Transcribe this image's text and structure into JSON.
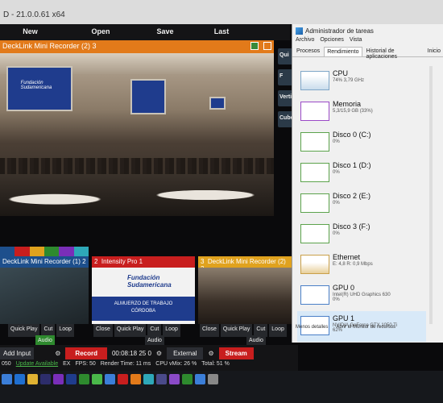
{
  "window": {
    "title": "D - 21.0.0.61 x64"
  },
  "menu": [
    "New",
    "Open",
    "Save",
    "Last"
  ],
  "preview": {
    "title": "DeckLink Mini Recorder (2) 3",
    "screen_text": "Fundación Sudamericana"
  },
  "quick_buttons": [
    "Qui",
    "F",
    "Vertic",
    "Cubo"
  ],
  "inputs": [
    {
      "number": "",
      "title": "DeckLink Mini Recorder (1) 2"
    },
    {
      "number": "2",
      "title": "Intensity Pro 1",
      "lower_third": "ALMUERZO DE TRABAJO\nCÓRDOBA",
      "logo": "Fundación Sudamericana"
    },
    {
      "number": "3",
      "title": "DeckLink Mini Recorder (2) 3"
    }
  ],
  "input_controls": {
    "i1": [
      "Quick Play",
      "Cut",
      "Loop"
    ],
    "i1b": [
      "Audio"
    ],
    "i2": [
      "Close",
      "Quick Play",
      "Cut",
      "Loop"
    ],
    "i2b": [
      "Audio"
    ],
    "i3": [
      "Close",
      "Quick Play",
      "Cut",
      "Loop"
    ],
    "i3b": [
      "Audio"
    ]
  },
  "bottom": {
    "add_input": "Add Input",
    "record": "Record",
    "timecode": "00:08:18 25 0",
    "external": "External",
    "stream": "Stream"
  },
  "status": {
    "version": "050",
    "update": "Update Available",
    "ex": "EX",
    "fps": "FPS: 50",
    "render": "Render Time: 11 ms",
    "cpu": "CPU vMix: 26 %",
    "total": "Total: 51 %"
  },
  "task_manager": {
    "title": "Administrador de tareas",
    "menu": [
      "Archivo",
      "Opciones",
      "Vista"
    ],
    "tabs": [
      "Procesos",
      "Rendimiento",
      "Historial de aplicaciones",
      "Inicio"
    ],
    "active_tab": "Rendimiento",
    "resources": [
      {
        "name": "CPU",
        "detail": "74%  3,79 GHz",
        "kind": "cpu"
      },
      {
        "name": "Memoria",
        "detail": "5,3/15,9 GB (33%)",
        "kind": "mem"
      },
      {
        "name": "Disco 0 (C:)",
        "detail": "0%",
        "kind": "disk"
      },
      {
        "name": "Disco 1 (D:)",
        "detail": "0%",
        "kind": "disk"
      },
      {
        "name": "Disco 2 (E:)",
        "detail": "0%",
        "kind": "disk"
      },
      {
        "name": "Disco 3 (F:)",
        "detail": "0%",
        "kind": "disk"
      },
      {
        "name": "Ethernet",
        "detail": "E: 4,8  R: 0,9 Mbps",
        "kind": "net"
      },
      {
        "name": "GPU 0",
        "detail": "Intel(R) UHD Graphics 630\n0%",
        "kind": "gpu"
      },
      {
        "name": "GPU 1",
        "detail": "NVIDIA GeForce GTX 1050 Ti\n62%",
        "kind": "gpu"
      }
    ],
    "footer_less": "Menos detalles",
    "footer_monitor": "Abrir el Monitor de recursos"
  },
  "colors": {
    "accent_orange": "#e27a1a",
    "record_red": "#c81e1e",
    "input_blue": "#1d4f8c",
    "input_yellow": "#e0a21e",
    "audio_green": "#2e8a2e"
  }
}
